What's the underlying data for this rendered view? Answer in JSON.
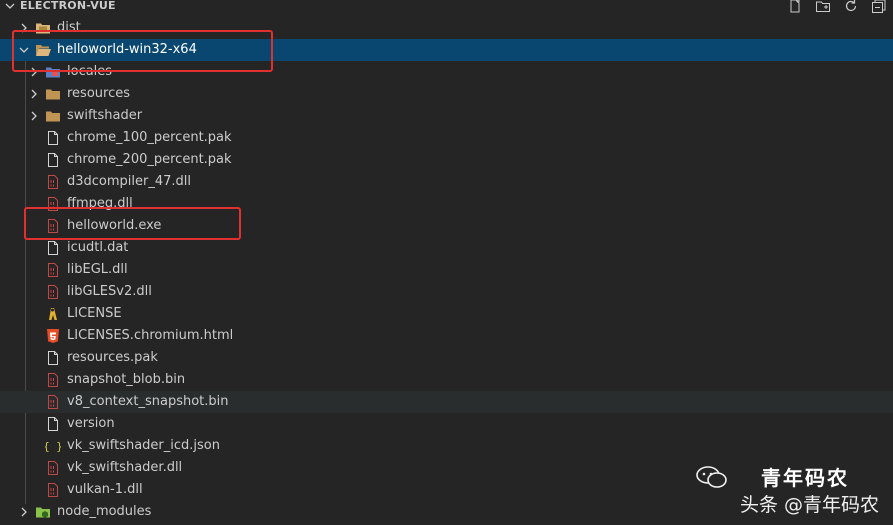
{
  "explorer": {
    "title": "ELECTRON-VUE",
    "actions": [
      "new-file-icon",
      "new-folder-icon",
      "refresh-icon",
      "collapse-all-icon"
    ]
  },
  "tree": [
    {
      "label": "dist",
      "kind": "folder",
      "depth": 0,
      "expanded": false,
      "icon": "folder-yellow-icon"
    },
    {
      "label": "helloworld-win32-x64",
      "kind": "folder",
      "depth": 0,
      "expanded": true,
      "selected": true,
      "icon": "folder-open-icon"
    },
    {
      "label": "locales",
      "kind": "folder",
      "depth": 1,
      "expanded": false,
      "icon": "folder-locales-icon"
    },
    {
      "label": "resources",
      "kind": "folder",
      "depth": 1,
      "expanded": false,
      "icon": "folder-icon"
    },
    {
      "label": "swiftshader",
      "kind": "folder",
      "depth": 1,
      "expanded": false,
      "icon": "folder-icon"
    },
    {
      "label": "chrome_100_percent.pak",
      "kind": "file",
      "depth": 1,
      "icon": "file-icon"
    },
    {
      "label": "chrome_200_percent.pak",
      "kind": "file",
      "depth": 1,
      "icon": "file-icon"
    },
    {
      "label": "d3dcompiler_47.dll",
      "kind": "file",
      "depth": 1,
      "icon": "binary-file-icon"
    },
    {
      "label": "ffmpeg.dll",
      "kind": "file",
      "depth": 1,
      "icon": "binary-file-icon"
    },
    {
      "label": "helloworld.exe",
      "kind": "file",
      "depth": 1,
      "icon": "binary-file-icon"
    },
    {
      "label": "icudtl.dat",
      "kind": "file",
      "depth": 1,
      "icon": "file-icon"
    },
    {
      "label": "libEGL.dll",
      "kind": "file",
      "depth": 1,
      "icon": "binary-file-icon"
    },
    {
      "label": "libGLESv2.dll",
      "kind": "file",
      "depth": 1,
      "icon": "binary-file-icon"
    },
    {
      "label": "LICENSE",
      "kind": "file",
      "depth": 1,
      "icon": "license-icon"
    },
    {
      "label": "LICENSES.chromium.html",
      "kind": "file",
      "depth": 1,
      "icon": "html5-icon"
    },
    {
      "label": "resources.pak",
      "kind": "file",
      "depth": 1,
      "icon": "file-icon"
    },
    {
      "label": "snapshot_blob.bin",
      "kind": "file",
      "depth": 1,
      "icon": "binary-file-icon"
    },
    {
      "label": "v8_context_snapshot.bin",
      "kind": "file",
      "depth": 1,
      "icon": "binary-file-icon",
      "hover": true
    },
    {
      "label": "version",
      "kind": "file",
      "depth": 1,
      "icon": "file-icon"
    },
    {
      "label": "vk_swiftshader_icd.json",
      "kind": "file",
      "depth": 1,
      "icon": "json-icon"
    },
    {
      "label": "vk_swiftshader.dll",
      "kind": "file",
      "depth": 1,
      "icon": "binary-file-icon"
    },
    {
      "label": "vulkan-1.dll",
      "kind": "file",
      "depth": 1,
      "icon": "binary-file-icon"
    },
    {
      "label": "node_modules",
      "kind": "folder",
      "depth": 0,
      "expanded": false,
      "icon": "folder-node-icon"
    }
  ],
  "watermark": {
    "line1": "青年码农",
    "line2": "头条 @青年码农"
  },
  "colors": {
    "background": "#252526",
    "selection": "#094771",
    "highlight_box": "#e03030",
    "folder": "#dcb67a",
    "binary": "#c04848"
  }
}
